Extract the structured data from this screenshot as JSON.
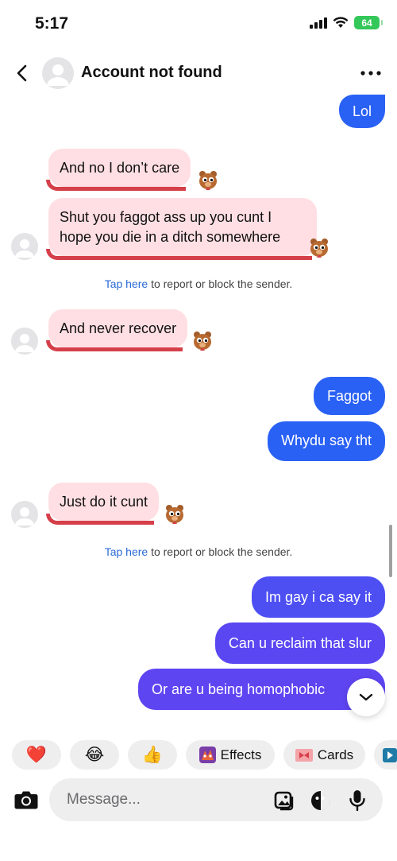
{
  "status_bar": {
    "time": "5:17",
    "battery": "64"
  },
  "header": {
    "title": "Account not found"
  },
  "messages": [
    {
      "text": "Lol"
    },
    {
      "text": "And no I don’t care"
    },
    {
      "text": "Shut you faggot ass up you cunt I hope you die in a ditch somewhere"
    },
    {
      "text": "And never recover"
    },
    {
      "text": "Faggot"
    },
    {
      "text": "Whydu say tht"
    },
    {
      "text": "Just do it cunt"
    },
    {
      "text": "Im gay i ca say it"
    },
    {
      "text": "Can u reclaim that slur"
    },
    {
      "text": "Or are u being homophobic"
    }
  ],
  "report_notice": {
    "link": "Tap here",
    "rest": " to report or block the sender."
  },
  "quick_actions": {
    "heart": "❤️",
    "laugh": "😂",
    "thumbs": "👍",
    "effects": "Effects",
    "cards": "Cards"
  },
  "composer": {
    "placeholder": "Message..."
  },
  "colors": {
    "outgoing_blue": "#2a61f5",
    "outgoing_purple": "#5e45f2",
    "incoming_bg": "#ffdfe3",
    "incoming_underline": "#d53f4a",
    "link": "#2b6bd6"
  }
}
